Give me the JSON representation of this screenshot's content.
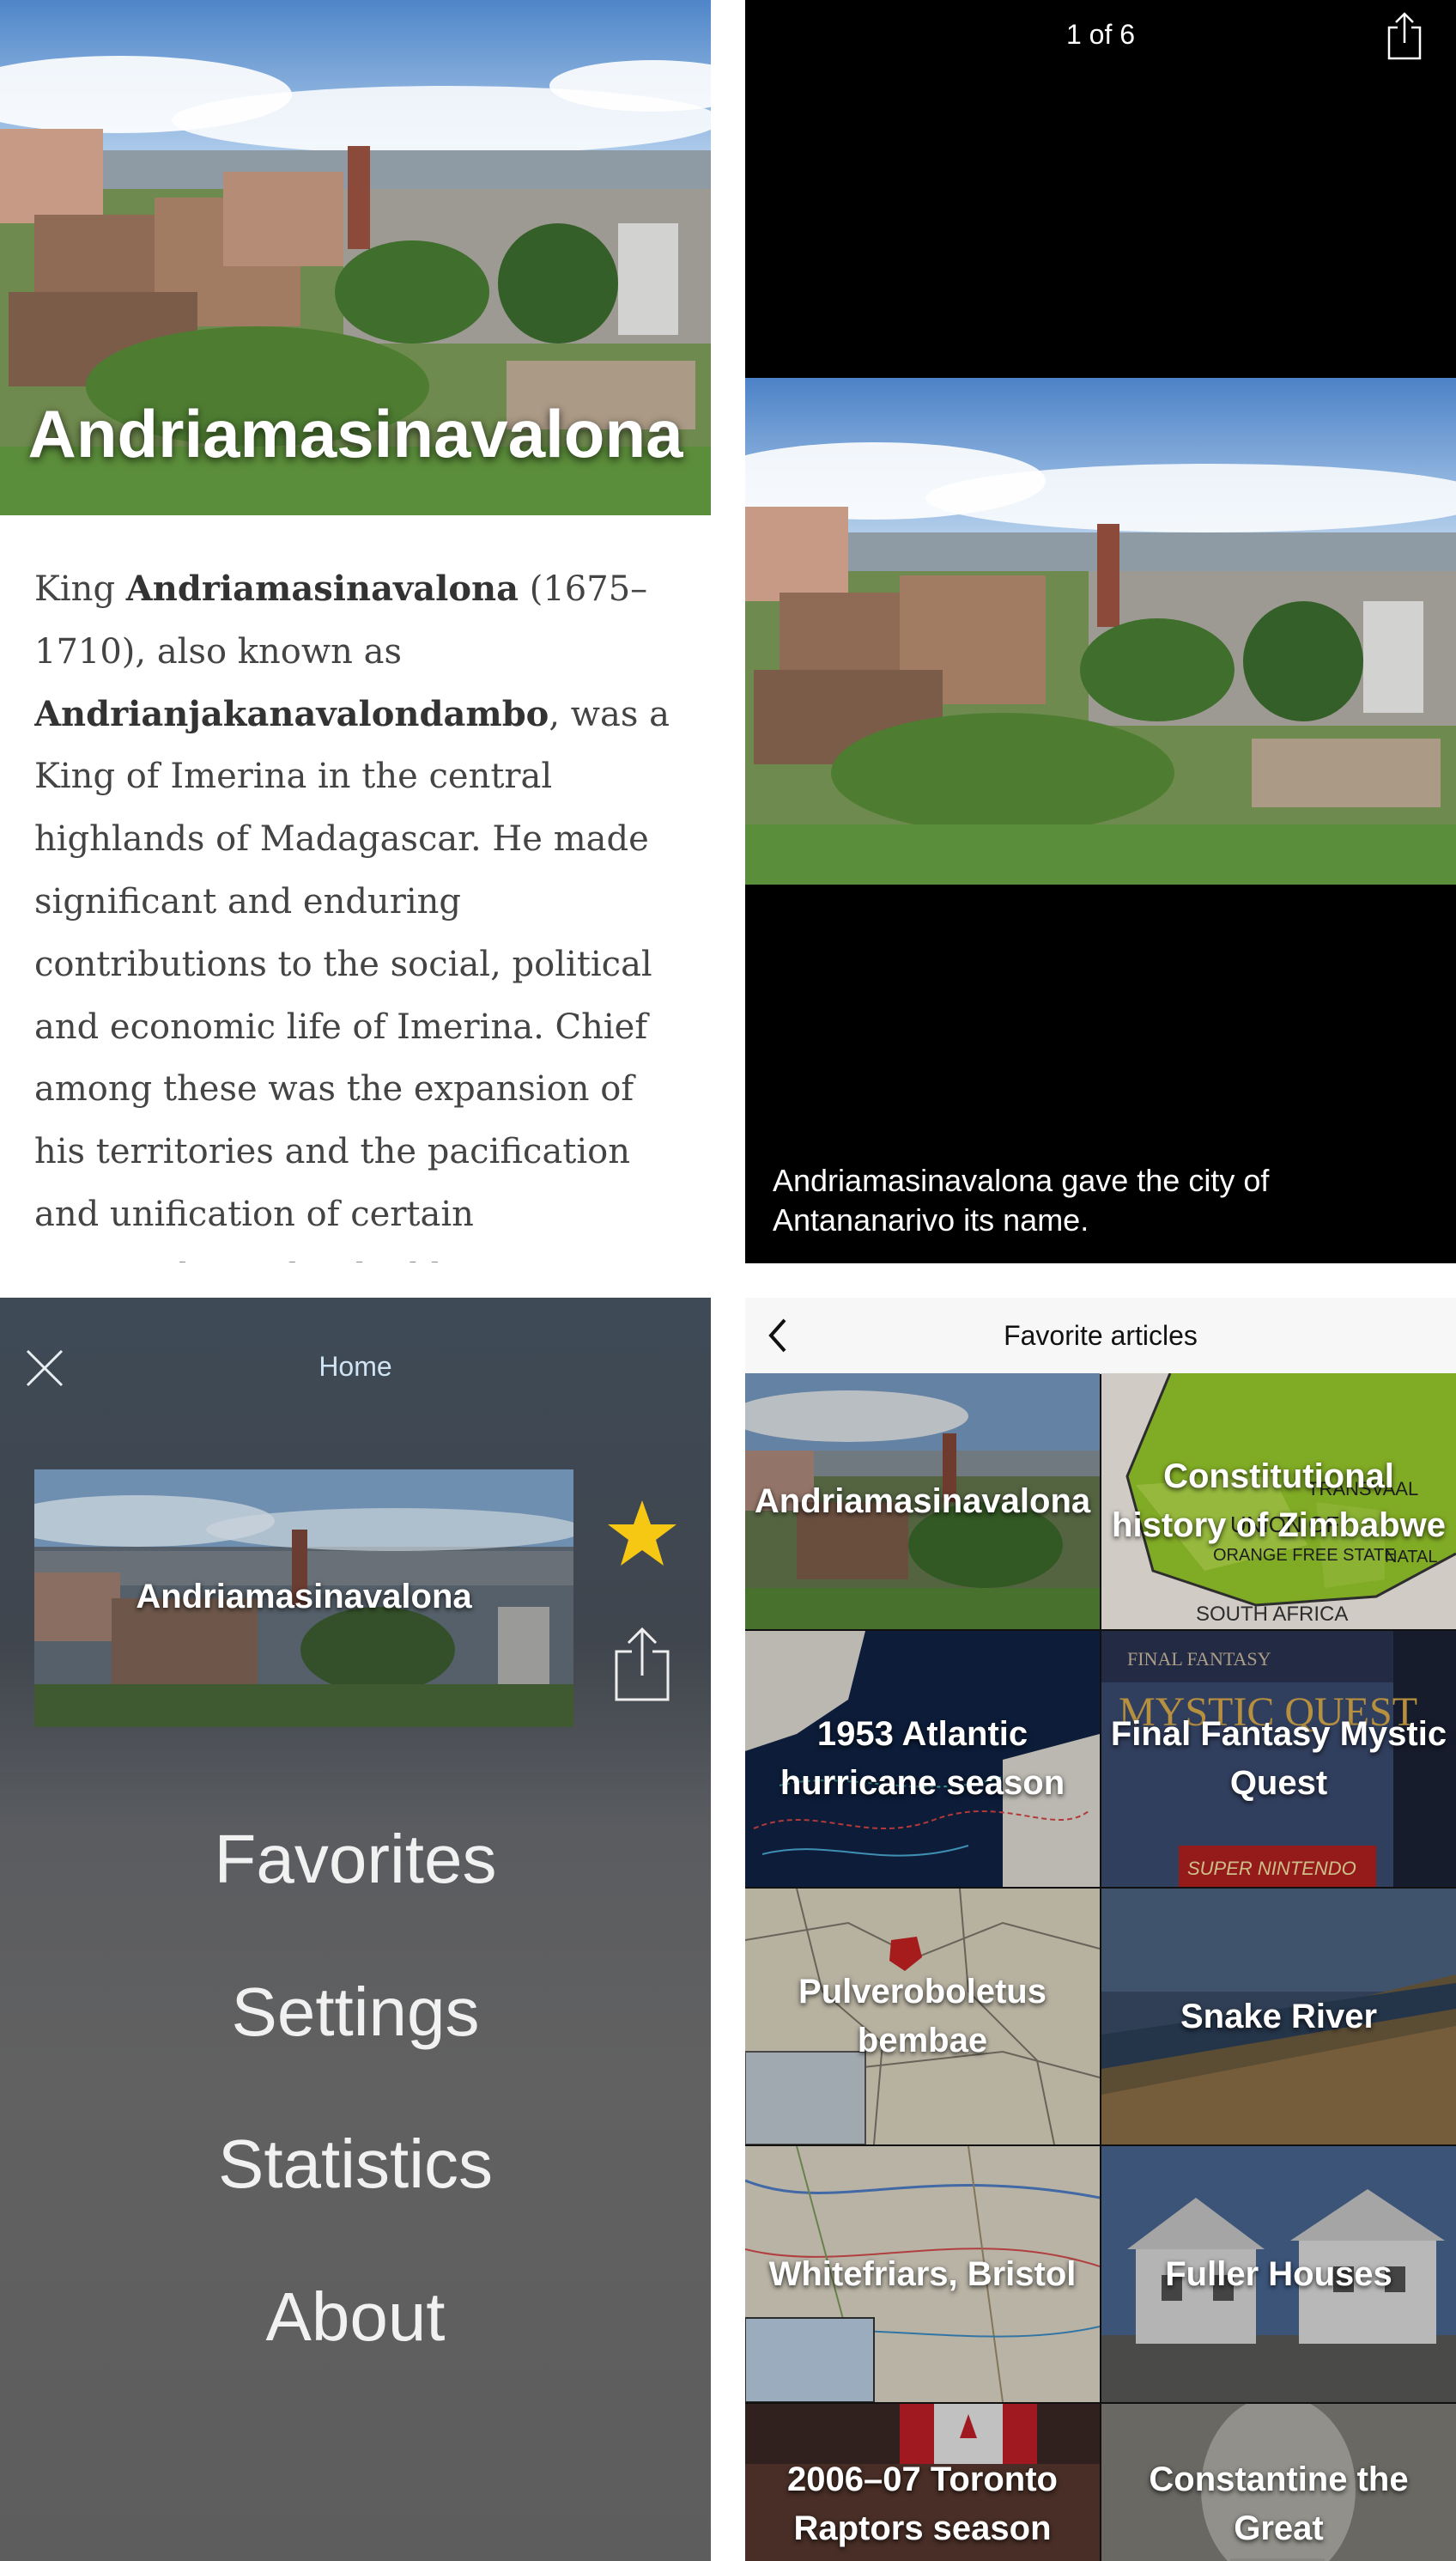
{
  "article": {
    "title": "Andriamasinavalona",
    "body_intro": "King ",
    "body_name": "Andriamasinavalona",
    "body_mid": " (1675–1710), also known as ",
    "body_alias": "Andrianjakanavalondambo",
    "body_rest": ", was a King of Imerina in the central highlands of Madagascar. He made significant and enduring contributions to the social, political and economic life of Imerina. Chief among these was the expansion of his territories and the pacification and unification of certain principalities that had become locked in violent conflicts."
  },
  "gallery": {
    "counter": "1 of 6",
    "caption": "Andriamasinavalona gave the city of Antananarivo its name.",
    "share_icon": "share-icon"
  },
  "menu": {
    "header_title": "Home",
    "close_icon": "close-icon",
    "card_title": "Andriamasinavalona",
    "star_icon": "star-icon",
    "star_color": "#f6c813",
    "share_icon": "share-icon",
    "items": [
      {
        "label": "Favorites"
      },
      {
        "label": "Settings"
      },
      {
        "label": "Statistics"
      },
      {
        "label": "About"
      }
    ]
  },
  "favorites": {
    "header_title": "Favorite articles",
    "back_icon": "chevron-left-icon",
    "tiles": [
      {
        "label": "Andriamasinavalona"
      },
      {
        "label": "Constitutional history of Zimbabwe"
      },
      {
        "label": "1953 Atlantic hurricane season"
      },
      {
        "label": "Final Fantasy Mystic Quest"
      },
      {
        "label": "Pulveroboletus bembae"
      },
      {
        "label": "Snake River"
      },
      {
        "label": "Whitefriars, Bristol"
      },
      {
        "label": "Fuller Houses"
      },
      {
        "label": "2006–07 Toronto Raptors season"
      },
      {
        "label": "Constantine the Great"
      }
    ]
  },
  "map_labels": {
    "transvaal": "TRANSVAAL",
    "union_of": "UNION OF",
    "orange_free_state": "ORANGE FREE STATE",
    "natal": "NATAL",
    "south_africa": "SOUTH AFRICA",
    "ff_banner": "FINAL FANTASY",
    "ff_logo": "MYSTIC QUEST",
    "snes": "SUPER NINTENDO"
  }
}
